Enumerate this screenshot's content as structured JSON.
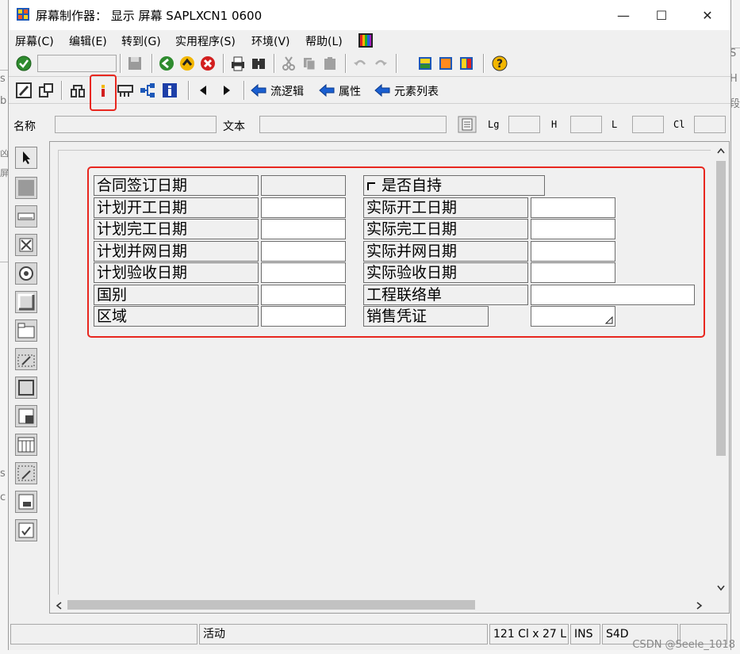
{
  "window": {
    "title": "屏幕制作器： 显示 屏幕 SAPLXCN1 0600",
    "minimize": "—",
    "maximize": "☐",
    "close": "✕"
  },
  "menu": [
    {
      "label": "屏幕(C)"
    },
    {
      "label": "编辑(E)"
    },
    {
      "label": "转到(G)"
    },
    {
      "label": "实用程序(S)"
    },
    {
      "label": "环境(V)"
    },
    {
      "label": "帮助(L)"
    }
  ],
  "toolbar2": {
    "flow_logic": "流逻辑",
    "attributes": "属性",
    "element_list": "元素列表"
  },
  "fields": {
    "name_label": "名称",
    "text_label": "文本",
    "lg_label": "Lg",
    "h_label": "H",
    "l_label": "L",
    "cl_label": "Cl"
  },
  "screen_elements": {
    "contract_date": "合同签订日期",
    "self_hold": "是否自持",
    "plan_start": "计划开工日期",
    "actual_start": "实际开工日期",
    "plan_finish": "计划完工日期",
    "actual_finish": "实际完工日期",
    "plan_grid": "计划并网日期",
    "actual_grid": "实际并网日期",
    "plan_accept": "计划验收日期",
    "actual_accept": "实际验收日期",
    "country": "国别",
    "project_contact": "工程联络单",
    "region": "区域",
    "sales_voucher": "销售凭证"
  },
  "status": {
    "mode": "活动",
    "position": "121 Cl x 27 L",
    "ins": "INS",
    "system": "S4D"
  },
  "watermark": "CSDN @Seele_1018",
  "colors": {
    "highlight": "#e8271f",
    "arrow": "#1a5fd1"
  }
}
